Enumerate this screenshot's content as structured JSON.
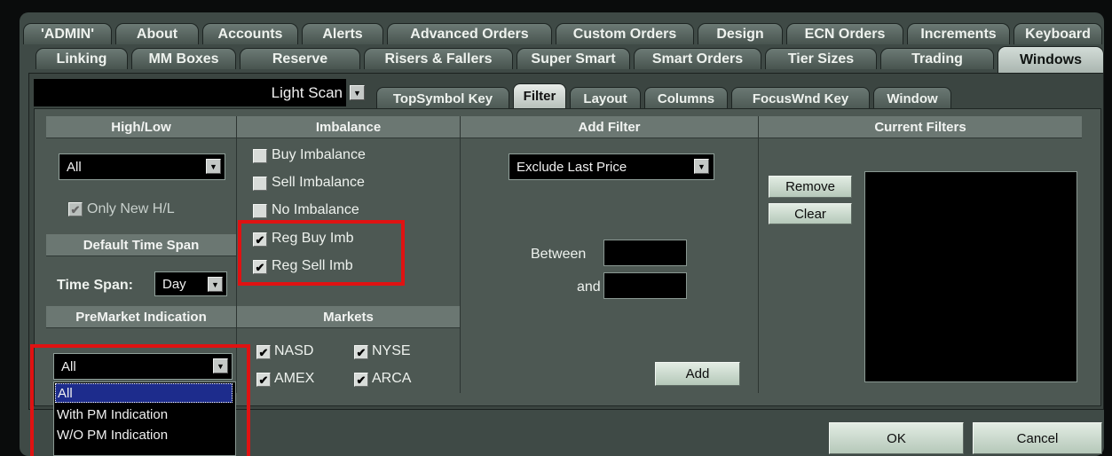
{
  "top_tabs_row1": [
    "'ADMIN'",
    "About",
    "Accounts",
    "Alerts",
    "Advanced Orders",
    "Custom Orders",
    "Design",
    "ECN Orders",
    "Increments",
    "Keyboard"
  ],
  "top_tabs_row2": [
    "Linking",
    "MM Boxes",
    "Reserve",
    "Risers & Fallers",
    "Super Smart",
    "Smart Orders",
    "Tier Sizes",
    "Trading",
    "Windows"
  ],
  "active_top_tab": "Windows",
  "scan": {
    "selected": "Light Scan"
  },
  "sub_tabs": [
    "TopSymbol Key",
    "Filter",
    "Layout",
    "Columns",
    "FocusWnd Key",
    "Window"
  ],
  "active_sub_tab": "Filter",
  "high_low": {
    "header": "High/Low",
    "select_value": "All",
    "only_new_label": "Only New H/L",
    "only_new_checked": true
  },
  "default_time_span": {
    "header": "Default Time Span",
    "label": "Time Span:",
    "value": "Day"
  },
  "premarket": {
    "header": "PreMarket Indication",
    "select_value": "All",
    "options": [
      "All",
      "With PM Indication",
      "W/O PM Indication"
    ],
    "highlighted_option": "All"
  },
  "imbalance": {
    "header": "Imbalance",
    "items": [
      {
        "label": "Buy Imbalance",
        "checked": false
      },
      {
        "label": "Sell Imbalance",
        "checked": false
      },
      {
        "label": "No Imbalance",
        "checked": false
      },
      {
        "label": "Reg Buy Imb",
        "checked": true
      },
      {
        "label": "Reg Sell Imb",
        "checked": true
      }
    ]
  },
  "markets": {
    "header": "Markets",
    "items": [
      {
        "label": "NASD",
        "checked": true
      },
      {
        "label": "NYSE",
        "checked": true
      },
      {
        "label": "AMEX",
        "checked": true
      },
      {
        "label": "ARCA",
        "checked": true
      }
    ]
  },
  "add_filter": {
    "header": "Add Filter",
    "select_value": "Exclude Last Price",
    "between_label": "Between",
    "and_label": "and",
    "between_value": "",
    "and_value": "",
    "add_button": "Add"
  },
  "current_filters": {
    "header": "Current Filters",
    "remove_button": "Remove",
    "clear_button": "Clear"
  },
  "footer": {
    "ok_button": "OK",
    "cancel_button": "Cancel"
  },
  "colors": {
    "panel": "#4d5853",
    "header": "#6b7772",
    "highlight": "#e01212",
    "selection": "#1d2c8c"
  }
}
